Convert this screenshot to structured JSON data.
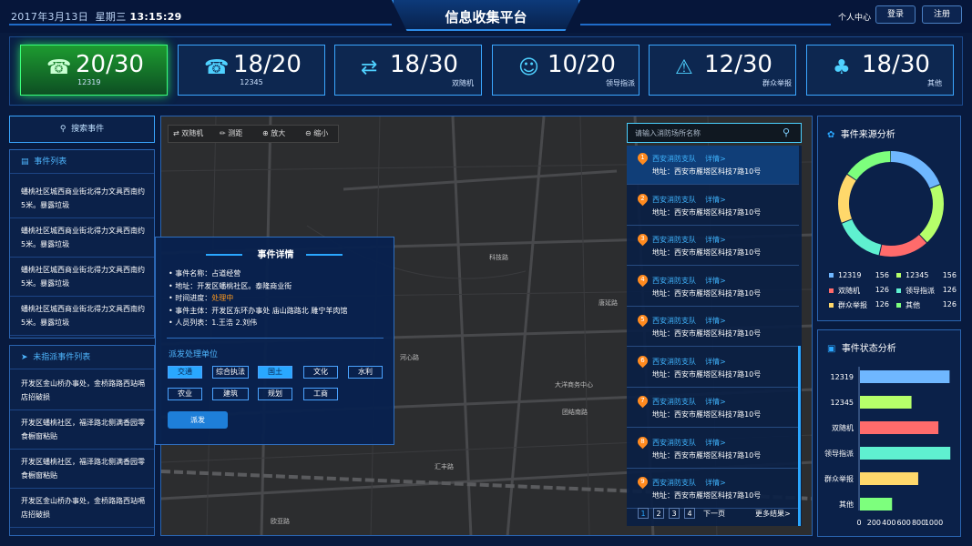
{
  "header": {
    "date": "2017年3月13日",
    "weekday": "星期三",
    "time": "13:15:29",
    "title": "信息收集平台",
    "personal": "个人中心",
    "login": "登录",
    "register": "注册"
  },
  "stats": [
    {
      "num": "20/30",
      "label": "12319",
      "icon": "phone-icon"
    },
    {
      "num": "18/20",
      "label": "12345",
      "icon": "phone-24-icon"
    },
    {
      "num": "18/30",
      "label": "双随机",
      "icon": "shuffle-icon"
    },
    {
      "num": "10/20",
      "label": "领导指派",
      "icon": "user-assign-icon"
    },
    {
      "num": "12/30",
      "label": "群众举报",
      "icon": "warning-icon"
    },
    {
      "num": "18/30",
      "label": "其他",
      "icon": "clover-icon"
    }
  ],
  "left": {
    "search_label": "搜索事件",
    "events_title": "事件列表",
    "events": [
      "蟠桃社区城西商业街北得力文具西南约5米。暴露垃圾",
      "蟠桃社区城西商业街北得力文具西南约5米。暴露垃圾",
      "蟠桃社区城西商业街北得力文具西南约5米。暴露垃圾",
      "蟠桃社区城西商业街北得力文具西南约5米。暴露垃圾"
    ],
    "unassigned_title": "未指派事件列表",
    "unassigned": [
      "开发区金山桥办事处，金桥路路西站嗝店招破损",
      "开发区蟠桃社区，福泽路北侧满香园零食橱窗粘贴",
      "开发区蟠桃社区，福泽路北侧满香园零食橱窗粘贴",
      "开发区金山桥办事处，金桥路路西站嗝店招破损"
    ]
  },
  "map": {
    "tools": [
      "双随机",
      "测距",
      "放大",
      "缩小"
    ],
    "search_placeholder": "请输入消防场所名称",
    "labels": [
      "科技路",
      "河心路",
      "汇丰路",
      "团结南路",
      "大洋商务中心",
      "欧亚路",
      "唐延路"
    ]
  },
  "results": {
    "items": [
      {
        "n": "1",
        "name": "西安消防支队",
        "detail": "详情>",
        "addr": "地址：西安市雁塔区科技7路10号"
      },
      {
        "n": "2",
        "name": "西安消防支队",
        "detail": "详情>",
        "addr": "地址：西安市雁塔区科技7路10号"
      },
      {
        "n": "3",
        "name": "西安消防支队",
        "detail": "详情>",
        "addr": "地址：西安市雁塔区科技7路10号"
      },
      {
        "n": "4",
        "name": "西安消防支队",
        "detail": "详情>",
        "addr": "地址：西安市雁塔区科技7路10号"
      },
      {
        "n": "5",
        "name": "西安消防支队",
        "detail": "详情>",
        "addr": "地址：西安市雁塔区科技7路10号"
      },
      {
        "n": "6",
        "name": "西安消防支队",
        "detail": "详情>",
        "addr": "地址：西安市雁塔区科技7路10号"
      },
      {
        "n": "7",
        "name": "西安消防支队",
        "detail": "详情>",
        "addr": "地址：西安市雁塔区科技7路10号"
      },
      {
        "n": "8",
        "name": "西安消防支队",
        "detail": "详情>",
        "addr": "地址：西安市雁塔区科技7路10号"
      },
      {
        "n": "9",
        "name": "西安消防支队",
        "detail": "详情>",
        "addr": "地址：西安市雁塔区科技7路10号"
      }
    ],
    "pages": [
      "1",
      "2",
      "3",
      "4"
    ],
    "next": "下一页",
    "more": "更多结果>"
  },
  "popup": {
    "title": "事件详情",
    "lines": [
      {
        "k": "事件名称：",
        "v": "占道经营"
      },
      {
        "k": "地址：",
        "v": "开发区蟠桃社区。泰隆商业街"
      },
      {
        "k": "时间进度：",
        "v": "处理中"
      },
      {
        "k": "事件主体：",
        "v": "开发区东环办事处 庙山路路北 雕宁羊肉馆"
      },
      {
        "k": "人员列表：",
        "v": "1.王浩  2.刘伟"
      }
    ],
    "dispatch_title": "派发处理单位",
    "tags_row1": [
      "交通",
      "综合执法",
      "国土",
      "文化",
      "水利"
    ],
    "tags_row2": [
      "农业",
      "建筑",
      "规划",
      "工商"
    ],
    "send": "派发",
    "status_color": "#ff9a1e"
  },
  "source": {
    "title": "事件来源分析",
    "legend": [
      {
        "name": "12319",
        "value": "156",
        "color": "#6fb7ff"
      },
      {
        "name": "12345",
        "value": "156",
        "color": "#b6ff6a"
      },
      {
        "name": "双随机",
        "value": "126",
        "color": "#ff6b6b"
      },
      {
        "name": "领导指派",
        "value": "126",
        "color": "#5ff0d0"
      },
      {
        "name": "群众举报",
        "value": "126",
        "color": "#ffd86b"
      },
      {
        "name": "其他",
        "value": "126",
        "color": "#7dff7d"
      }
    ]
  },
  "chart_data": {
    "type": "bar",
    "title": "事件状态分析",
    "categories": [
      "12319",
      "12345",
      "双随机",
      "领导指派",
      "群众举报",
      "其他"
    ],
    "values": [
      1200,
      690,
      1050,
      1210,
      780,
      430
    ],
    "colors": [
      "#6fb7ff",
      "#b6ff6a",
      "#ff6b6b",
      "#5ff0d0",
      "#ffd86b",
      "#7dff7d"
    ],
    "xlim": [
      0,
      1000
    ],
    "xticks": [
      "0",
      "200",
      "400",
      "600",
      "800",
      "1000"
    ]
  }
}
